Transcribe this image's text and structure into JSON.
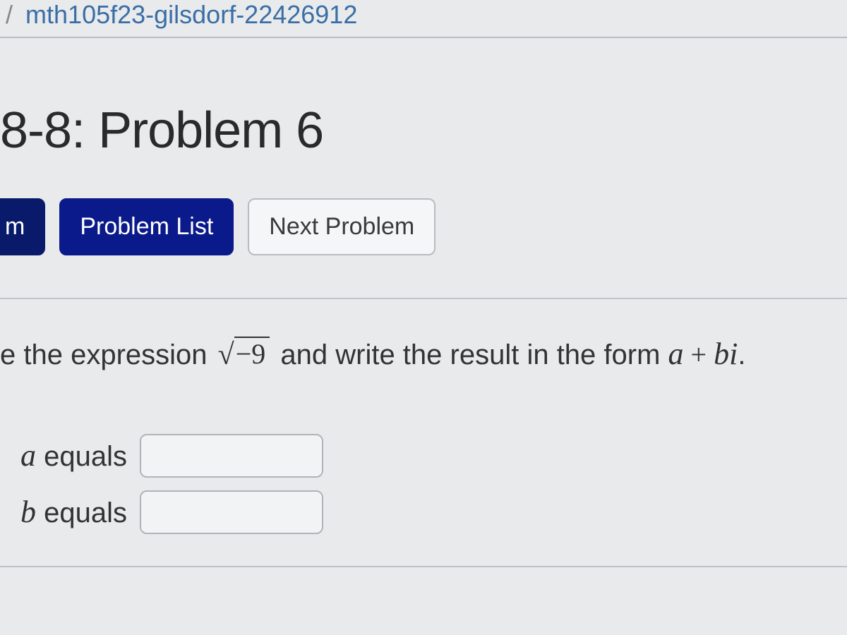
{
  "breadcrumb": {
    "sep": "/",
    "course": "mth105f23-gilsdorf-22426912"
  },
  "page": {
    "title": "8-8: Problem 6"
  },
  "nav": {
    "prev_partial": "m",
    "problem_list": "Problem List",
    "next_problem": "Next Problem"
  },
  "problem": {
    "prefix": "e the expression ",
    "radicand": "−9",
    "mid": " and write the result in the form ",
    "form_a": "a",
    "form_plus": " + ",
    "form_bi": "bi",
    "form_period": "."
  },
  "answers": {
    "a_label_var": "a",
    "a_label_word": " equals",
    "b_label_var": "b",
    "b_label_word": " equals",
    "a_value": "",
    "b_value": ""
  }
}
